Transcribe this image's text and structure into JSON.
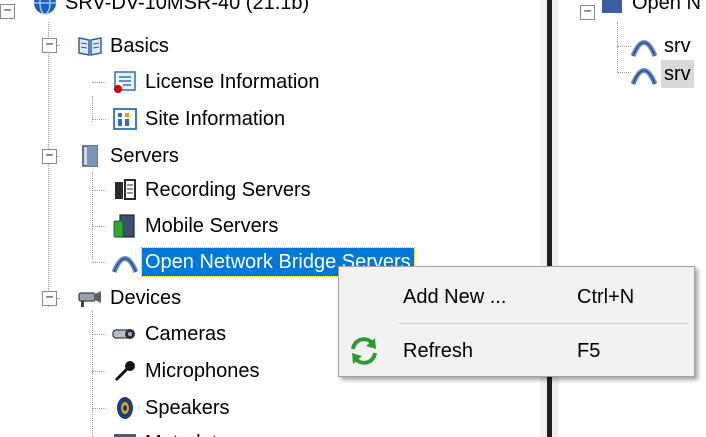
{
  "tree": {
    "root_label": "SRV-DV-10MSR-40 (21.1b)",
    "basics": {
      "label": "Basics",
      "children": {
        "license": "License Information",
        "site": "Site Information"
      }
    },
    "servers": {
      "label": "Servers",
      "children": {
        "recording": "Recording Servers",
        "mobile": "Mobile Servers",
        "onb": "Open Network Bridge Servers"
      }
    },
    "devices": {
      "label": "Devices",
      "children": {
        "cameras": "Cameras",
        "microphones": "Microphones",
        "speakers": "Speakers",
        "metadata": "Metadata"
      }
    }
  },
  "right_panel": {
    "root_label": "Open N",
    "items": [
      "srv",
      "srv"
    ]
  },
  "context_menu": {
    "add_new": {
      "label": "Add New ...",
      "shortcut": "Ctrl+N"
    },
    "refresh": {
      "label": "Refresh",
      "shortcut": "F5"
    }
  },
  "colors": {
    "selection": "#0078d7",
    "menu_bg": "#f2f2f2",
    "splitter": "#1f1f1f"
  }
}
